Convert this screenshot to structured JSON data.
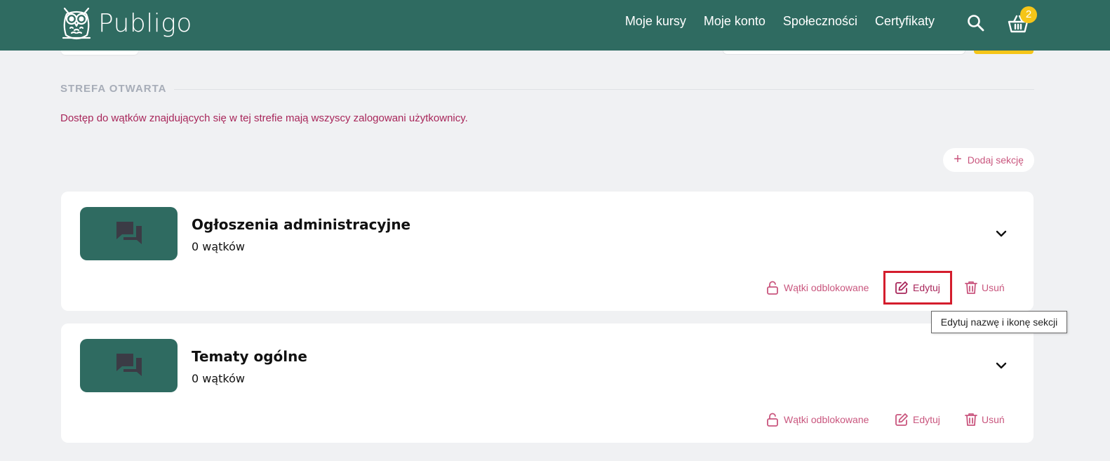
{
  "header": {
    "logo_text": "Publigo",
    "nav": [
      "Moje kursy",
      "Moje konto",
      "Społeczności",
      "Certyfikaty"
    ],
    "cart_count": "2",
    "search_icon": "search-icon",
    "cart_icon": "basket-icon"
  },
  "zone": {
    "title": "STREFA OTWARTA",
    "description": "Dostęp do wątków znajdujących się w tej strefie mają wszyscy zalogowani użytkownicy."
  },
  "add_section_label": "Dodaj sekcję",
  "sections": [
    {
      "title": "Ogłoszenia administracyjne",
      "threads": "0 wątków",
      "actions": {
        "unlock": "Wątki odblokowane",
        "edit": "Edytuj",
        "delete": "Usuń"
      }
    },
    {
      "title": "Tematy ogólne",
      "threads": "0 wątków",
      "actions": {
        "unlock": "Wątki odblokowane",
        "edit": "Edytuj",
        "delete": "Usuń"
      }
    }
  ],
  "tooltip": "Edytuj nazwę i ikonę sekcji",
  "colors": {
    "brand": "#2f6b61",
    "accent": "#c9567e",
    "badge": "#f5c518",
    "zone_desc": "#a8265a",
    "highlight": "#d41d2d"
  }
}
